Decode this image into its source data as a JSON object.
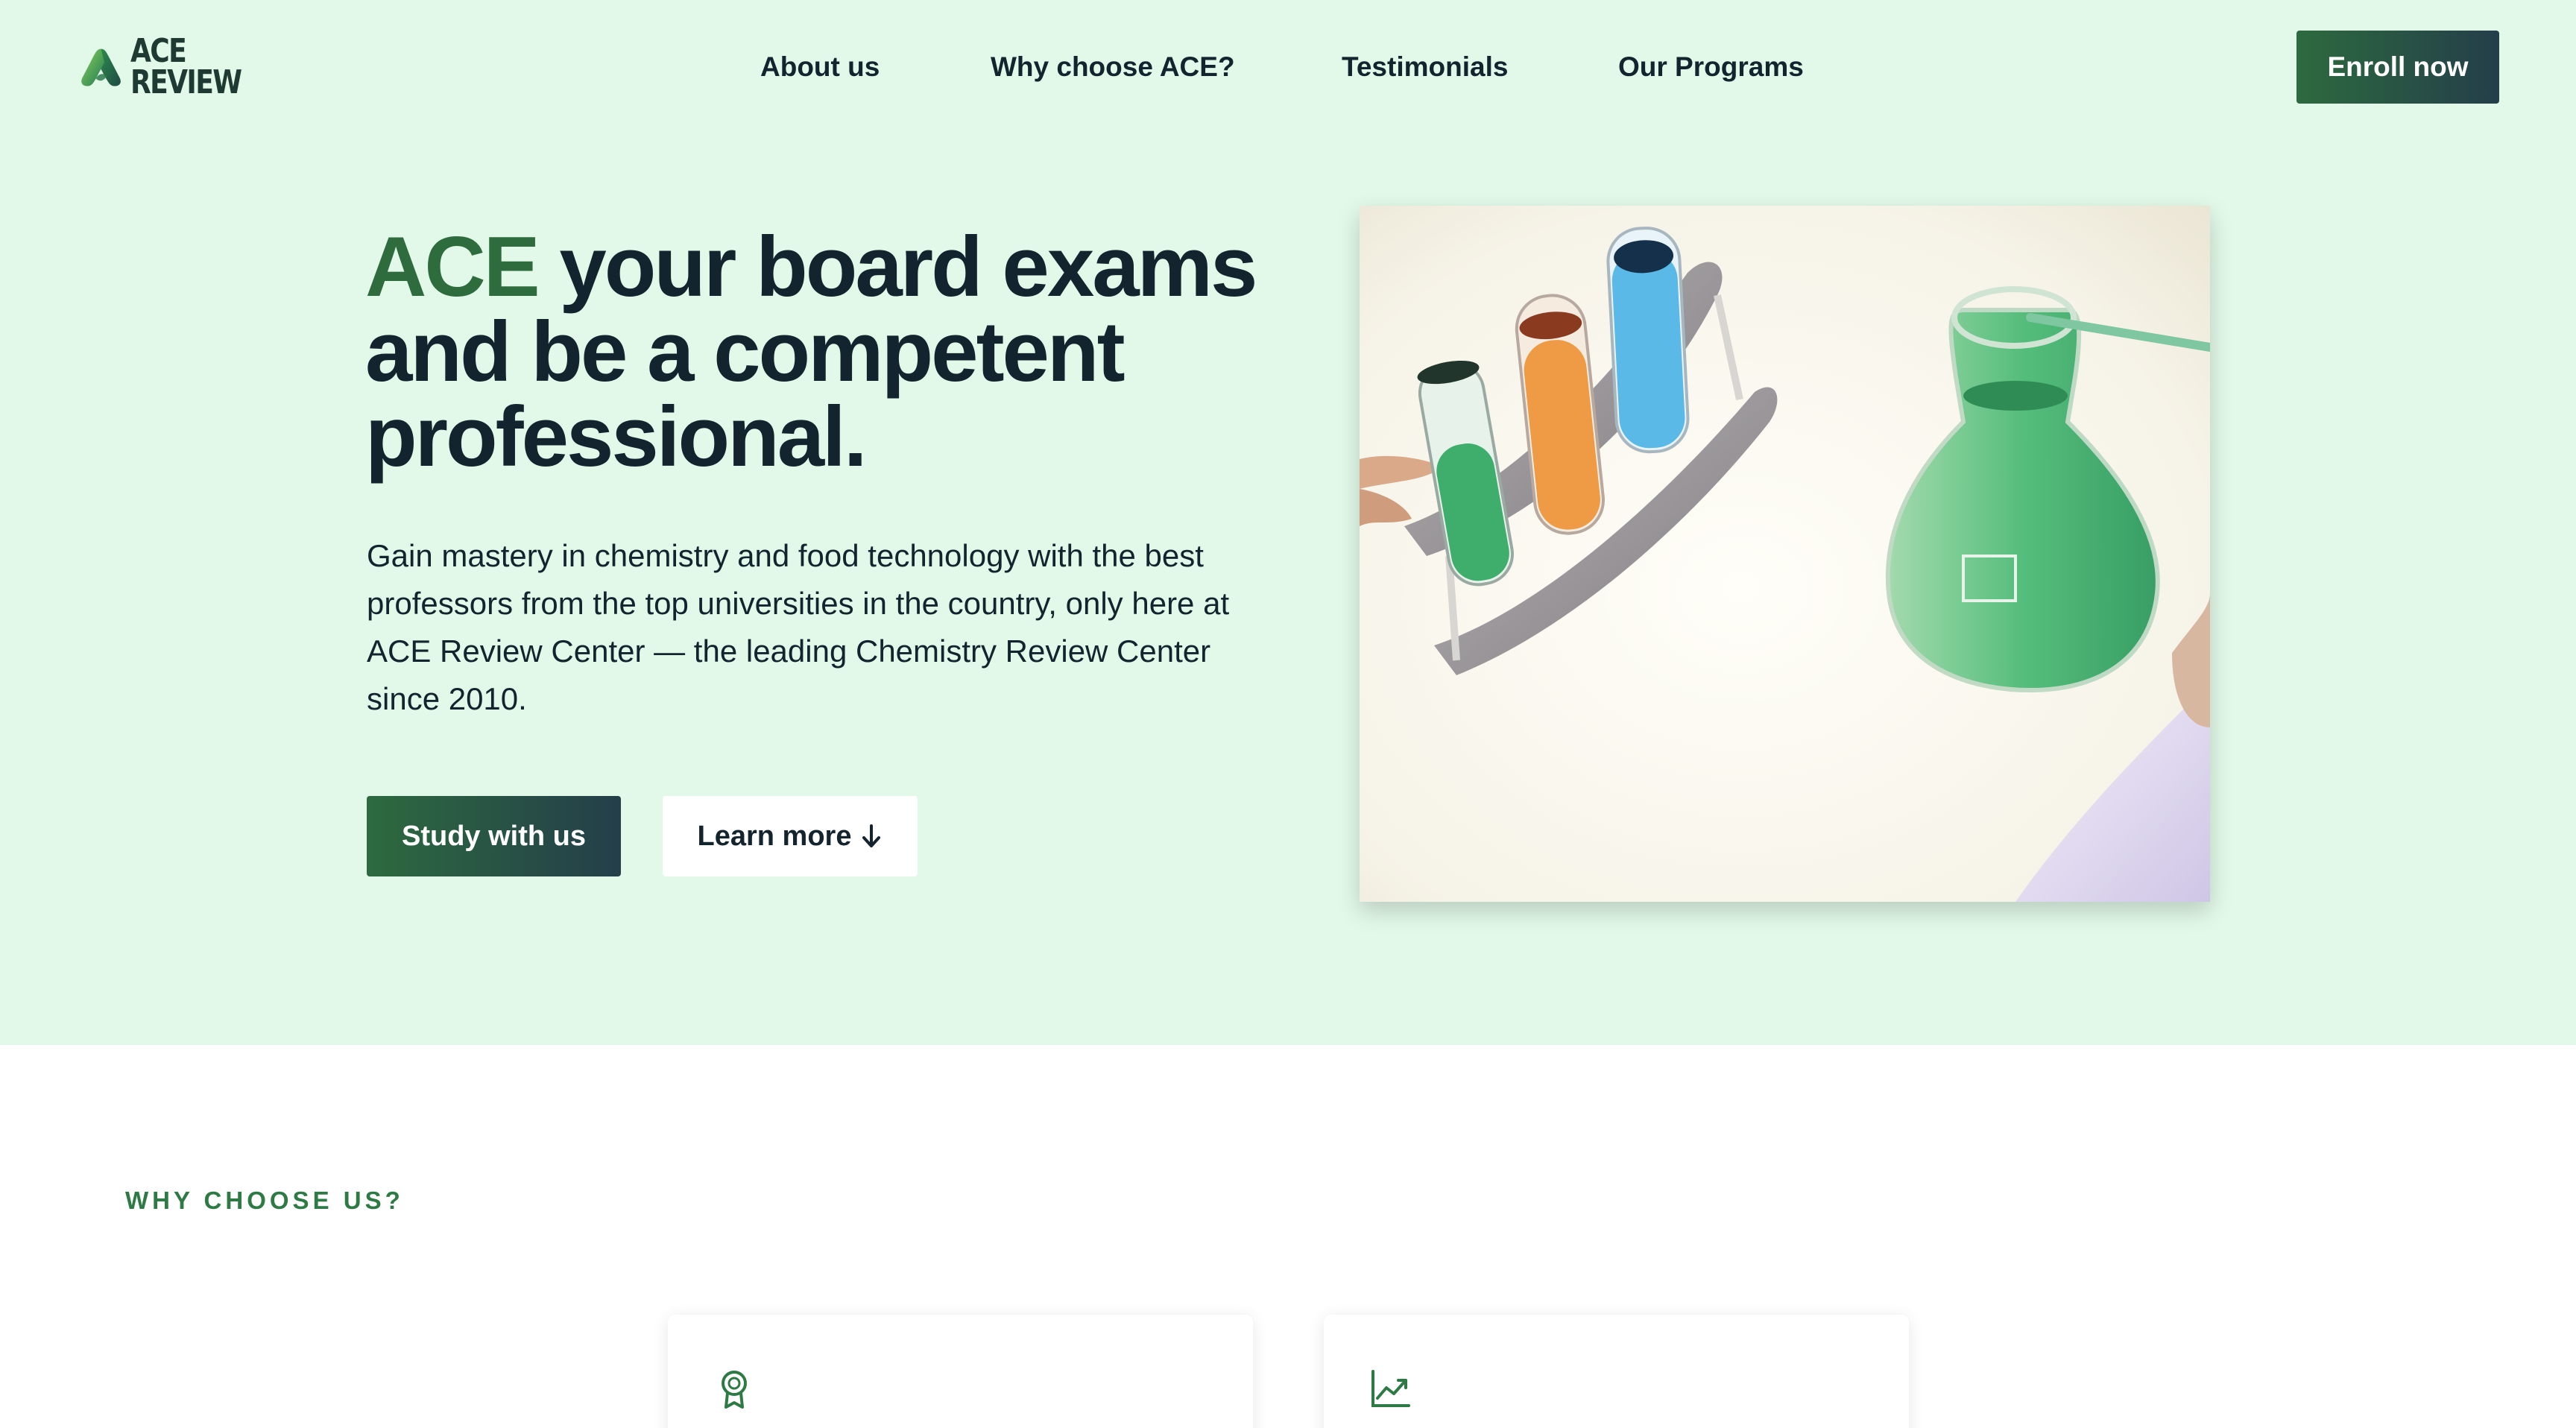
{
  "brand": {
    "name_line1": "ACE",
    "name_line2": "REVIEW",
    "logo_icon": "ace-review-logo"
  },
  "nav": {
    "items": [
      {
        "label": "About us"
      },
      {
        "label": "Why choose ACE?"
      },
      {
        "label": "Testimonials"
      },
      {
        "label": "Our Programs"
      }
    ],
    "cta_label": "Enroll now"
  },
  "hero": {
    "headline_accent": "ACE",
    "headline_rest": " your board exams and be a competent professional.",
    "description": "Gain mastery in chemistry and food technology with the best professors from the top universities in the country, only here at ACE Review Center — the leading Chemistry Review Center since 2010.",
    "primary_button": "Study with us",
    "secondary_button": "Learn more",
    "secondary_icon": "arrow-down-icon",
    "image": "laboratory-glassware-photo"
  },
  "why": {
    "label": "WHY CHOOSE US?",
    "cards": [
      {
        "icon": "award-icon"
      },
      {
        "icon": "chart-line-icon"
      }
    ]
  },
  "colors": {
    "hero_background": "#e2f8e8",
    "accent_green": "#2e6b3d",
    "text_dark": "#14242f",
    "button_gradient_start": "#2d6a3f",
    "button_gradient_end": "#243e4a",
    "section_label": "#2e7a44"
  }
}
